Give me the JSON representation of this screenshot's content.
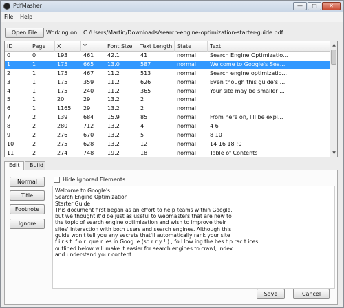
{
  "window": {
    "title": "PdfMasher",
    "min_glyph": "—",
    "max_glyph": "□",
    "close_glyph": "✕"
  },
  "menu": {
    "items": [
      "File",
      "Help"
    ]
  },
  "toolbar": {
    "open_label": "Open File",
    "working_label": "Working on:",
    "working_path": "C:/Users/Martin/Downloads/search-engine-optimization-starter-guide.pdf"
  },
  "table": {
    "columns": [
      "ID",
      "Page",
      "X",
      "Y",
      "Font Size",
      "Text Length",
      "State",
      "Text"
    ],
    "selected_row": 1,
    "rows": [
      [
        "0",
        "0",
        "193",
        "461",
        "42.1",
        "41",
        "normal",
        "Search Engine Optimizatio..."
      ],
      [
        "1",
        "1",
        "175",
        "665",
        "13.0",
        "587",
        "normal",
        "Welcome to Google's Sea..."
      ],
      [
        "2",
        "1",
        "175",
        "467",
        "11.2",
        "513",
        "normal",
        "Search engine optimizatio..."
      ],
      [
        "3",
        "1",
        "175",
        "359",
        "11.2",
        "626",
        "normal",
        "Even though this guide's ..."
      ],
      [
        "4",
        "1",
        "175",
        "240",
        "11.2",
        "365",
        "normal",
        "Your site may be smaller ..."
      ],
      [
        "5",
        "1",
        "20",
        "29",
        "13.2",
        "2",
        "normal",
        "!"
      ],
      [
        "6",
        "1",
        "1165",
        "29",
        "13.2",
        "2",
        "normal",
        "!"
      ],
      [
        "7",
        "2",
        "139",
        "684",
        "15.9",
        "85",
        "normal",
        "From here on, I'll be expl..."
      ],
      [
        "8",
        "2",
        "280",
        "712",
        "13.2",
        "4",
        "normal",
        "4 6"
      ],
      [
        "9",
        "2",
        "276",
        "670",
        "13.2",
        "5",
        "normal",
        "8 10"
      ],
      [
        "10",
        "2",
        "275",
        "628",
        "13.2",
        "12",
        "normal",
        "14 16 18 !0"
      ],
      [
        "11",
        "2",
        "274",
        "748",
        "19.2",
        "18",
        "normal",
        "Table of Contents"
      ]
    ]
  },
  "tabs": {
    "edit": "Edit",
    "build": "Build"
  },
  "panel": {
    "normal_label": "Normal",
    "title_label": "Title",
    "footnote_label": "Footnote",
    "ignore_label": "Ignore",
    "hide_ignored_label": "Hide Ignored Elements",
    "text_lines": [
      "Welcome to Google's",
      "Search Engine Optimization",
      "Starter Guide",
      "This document first began as an effort to help teams within Google,",
      "but we thought it'd be just as useful to webmasters that are new to",
      "the topic of search engine optimization and wish to improve their",
      "sites' interaction with both users and search engines. Although this",
      "guide won't tell you any secrets that'll automatically rank your site",
      "f i r s t  f o r  que r ies in Goog le (so r r y ! ) , fo l low ing the bes t p rac t ices",
      "outlined below will make it easier for search engines to crawl, index",
      "and understand your content."
    ],
    "save_label": "Save",
    "cancel_label": "Cancel"
  },
  "colors": {
    "selection": "#3399ff"
  }
}
